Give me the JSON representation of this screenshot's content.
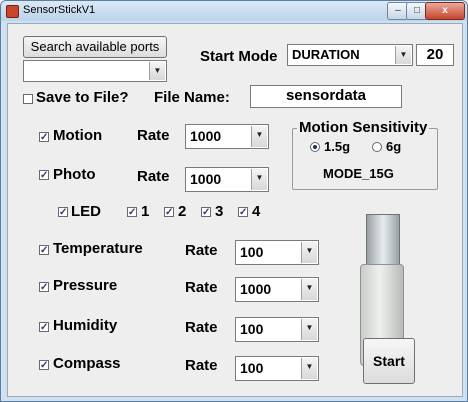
{
  "window": {
    "title": "SensorStickV1",
    "close_label": "x"
  },
  "top": {
    "search_button": "Search available ports",
    "port_value": "",
    "start_mode_label": "Start Mode",
    "start_mode_value": "DURATION",
    "duration_value": "20"
  },
  "save": {
    "label": "Save to File?",
    "checked": false,
    "file_name_label": "File Name:",
    "file_name_value": "sensordata"
  },
  "sensors": {
    "motion": {
      "label": "Motion",
      "checked": true,
      "rate_label": "Rate",
      "rate_value": "1000"
    },
    "photo": {
      "label": "Photo",
      "checked": true,
      "rate_label": "Rate",
      "rate_value": "1000"
    },
    "led": {
      "label": "LED",
      "checked": true,
      "items": [
        {
          "label": "1",
          "checked": true
        },
        {
          "label": "2",
          "checked": true
        },
        {
          "label": "3",
          "checked": true
        },
        {
          "label": "4",
          "checked": true
        }
      ]
    },
    "temperature": {
      "label": "Temperature",
      "checked": true,
      "rate_label": "Rate",
      "rate_value": "100"
    },
    "pressure": {
      "label": "Pressure",
      "checked": true,
      "rate_label": "Rate",
      "rate_value": "1000"
    },
    "humidity": {
      "label": "Humidity",
      "checked": true,
      "rate_label": "Rate",
      "rate_value": "100"
    },
    "compass": {
      "label": "Compass",
      "checked": true,
      "rate_label": "Rate",
      "rate_value": "100"
    }
  },
  "motion_sensitivity": {
    "title": "Motion Sensitivity",
    "options": [
      {
        "label": "1.5g",
        "selected": true
      },
      {
        "label": "6g",
        "selected": false
      }
    ],
    "mode_text": "MODE_15G"
  },
  "start_button": "Start",
  "icons": {
    "device": "usb-sensor-stick-image",
    "app": "matlab-icon"
  }
}
